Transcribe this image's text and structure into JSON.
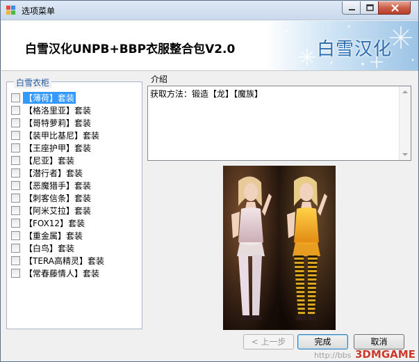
{
  "window": {
    "title": "选项菜单",
    "icons": {
      "app": "app-icon",
      "minimize": "minimize-icon",
      "maximize": "maximize-icon",
      "close": "close-icon"
    }
  },
  "banner": {
    "title": "白雪汉化UNPB+BBP衣服整合包V2.0",
    "logo_text": "白雪汉化"
  },
  "wardrobe": {
    "legend": "白雪衣柜",
    "items": [
      {
        "label": "【薄荷】套装",
        "checked": false,
        "selected": true
      },
      {
        "label": "【格洛里亚】套装",
        "checked": false
      },
      {
        "label": "【哥特萝莉】套装",
        "checked": false
      },
      {
        "label": "【装甲比基尼】套装",
        "checked": false
      },
      {
        "label": "【王座护甲】套装",
        "checked": false
      },
      {
        "label": "【尼亚】套装",
        "checked": false
      },
      {
        "label": "【潜行者】套装",
        "checked": false
      },
      {
        "label": "【恶魔猎手】套装",
        "checked": false
      },
      {
        "label": "【刺客信条】套装",
        "checked": false
      },
      {
        "label": "【阿米艾拉】套装",
        "checked": false
      },
      {
        "label": "【FOX12】套装",
        "checked": false
      },
      {
        "label": "【重金属】套装",
        "checked": false
      },
      {
        "label": "【白鸟】套装",
        "checked": false
      },
      {
        "label": "【TERA高精灵】套装",
        "checked": false
      },
      {
        "label": "【常春藤情人】套装",
        "checked": false
      }
    ]
  },
  "intro": {
    "legend": "介绍",
    "text": "获取方法：锻造【龙】【魔族】"
  },
  "buttons": {
    "back": "< 上一步",
    "finish": "完成",
    "cancel": "取消"
  },
  "watermark": {
    "url": "http://bbs",
    "logo": "3DMGAME"
  }
}
